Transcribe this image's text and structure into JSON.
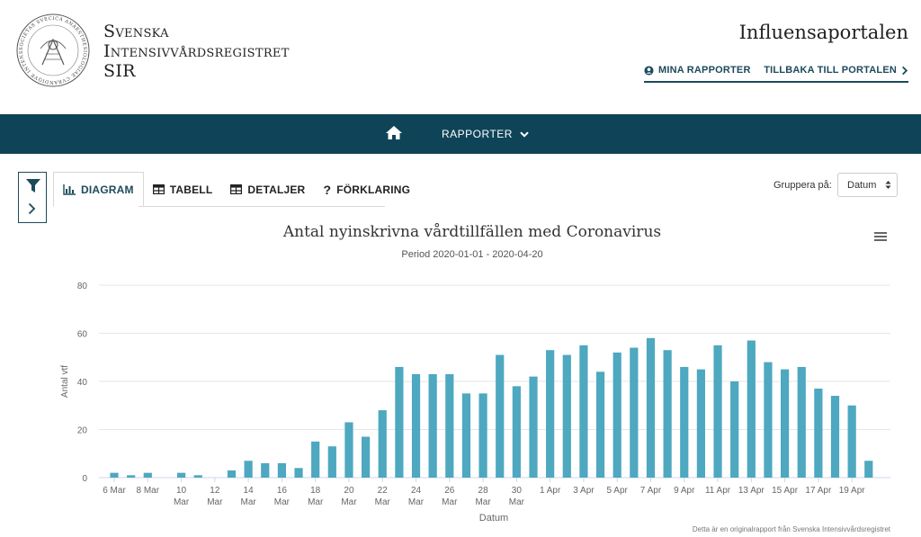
{
  "header": {
    "brand_line1": "Svenska",
    "brand_line2": "Intensivvårdsregistret",
    "brand_line3": "SIR",
    "portal_title": "Influensaportalen",
    "logo_text": "SOCIETAS SVECICA ANAESTHESIOLOGIAE CVRANDIQVE INTENSIVI"
  },
  "topnav": {
    "my_reports": "MINA RAPPORTER",
    "back": "TILLBAKA TILL PORTALEN",
    "my_reports_icon": "user-circle-icon",
    "back_icon": "chevron-right-icon"
  },
  "navbar": {
    "home_icon": "home-icon",
    "reports": "RAPPORTER",
    "reports_icon": "chevron-down-icon",
    "background": "#0f4458"
  },
  "toolbar": {
    "filter_icon": "filter-icon",
    "expand_icon": "chevron-right-icon",
    "tabs": [
      {
        "label": "DIAGRAM",
        "icon": "bar-chart-icon",
        "active": true
      },
      {
        "label": "TABELL",
        "icon": "table-icon",
        "active": false
      },
      {
        "label": "DETALJER",
        "icon": "table-icon",
        "active": false
      },
      {
        "label": "FÖRKLARING",
        "icon": "question-icon",
        "active": false
      }
    ],
    "group_label": "Gruppera på:",
    "group_value": "Datum"
  },
  "chart_footer": "Detta är en originalrapport från Svenska Intensivvårdsregistret",
  "chart_data": {
    "type": "bar",
    "title": "Antal nyinskrivna vårdtillfällen med Coronavirus",
    "subtitle": "Period 2020-01-01 - 2020-04-20",
    "xlabel": "Datum",
    "ylabel": "Antal vtf",
    "ylim": [
      0,
      80
    ],
    "yticks": [
      0,
      20,
      40,
      60,
      80
    ],
    "grid": true,
    "color": "#4da8c0",
    "categories": [
      "6 Mar",
      "7 Mar",
      "8 Mar",
      "9 Mar",
      "10 Mar",
      "11 Mar",
      "12 Mar",
      "13 Mar",
      "14 Mar",
      "15 Mar",
      "16 Mar",
      "17 Mar",
      "18 Mar",
      "19 Mar",
      "20 Mar",
      "21 Mar",
      "22 Mar",
      "23 Mar",
      "24 Mar",
      "25 Mar",
      "26 Mar",
      "27 Mar",
      "28 Mar",
      "29 Mar",
      "30 Mar",
      "31 Mar",
      "1 Apr",
      "2 Apr",
      "3 Apr",
      "4 Apr",
      "5 Apr",
      "6 Apr",
      "7 Apr",
      "8 Apr",
      "9 Apr",
      "10 Apr",
      "11 Apr",
      "12 Apr",
      "13 Apr",
      "14 Apr",
      "15 Apr",
      "16 Apr",
      "17 Apr",
      "18 Apr",
      "19 Apr",
      "20 Apr"
    ],
    "tick_labels": [
      [
        "6 Mar"
      ],
      null,
      [
        "8 Mar"
      ],
      null,
      [
        "10",
        "Mar"
      ],
      null,
      [
        "12",
        "Mar"
      ],
      null,
      [
        "14",
        "Mar"
      ],
      null,
      [
        "16",
        "Mar"
      ],
      null,
      [
        "18",
        "Mar"
      ],
      null,
      [
        "20",
        "Mar"
      ],
      null,
      [
        "22",
        "Mar"
      ],
      null,
      [
        "24",
        "Mar"
      ],
      null,
      [
        "26",
        "Mar"
      ],
      null,
      [
        "28",
        "Mar"
      ],
      null,
      [
        "30",
        "Mar"
      ],
      null,
      [
        "1 Apr"
      ],
      null,
      [
        "3 Apr"
      ],
      null,
      [
        "5 Apr"
      ],
      null,
      [
        "7 Apr"
      ],
      null,
      [
        "9 Apr"
      ],
      null,
      [
        "11 Apr"
      ],
      null,
      [
        "13 Apr"
      ],
      null,
      [
        "15 Apr"
      ],
      null,
      [
        "17 Apr"
      ],
      null,
      [
        "19 Apr"
      ],
      null
    ],
    "values": [
      2,
      1,
      2,
      0,
      2,
      1,
      0,
      3,
      7,
      6,
      6,
      4,
      15,
      13,
      23,
      17,
      28,
      46,
      43,
      43,
      43,
      35,
      35,
      51,
      38,
      42,
      53,
      51,
      55,
      44,
      52,
      54,
      58,
      53,
      46,
      45,
      55,
      40,
      57,
      48,
      45,
      46,
      37,
      34,
      30,
      7
    ]
  }
}
